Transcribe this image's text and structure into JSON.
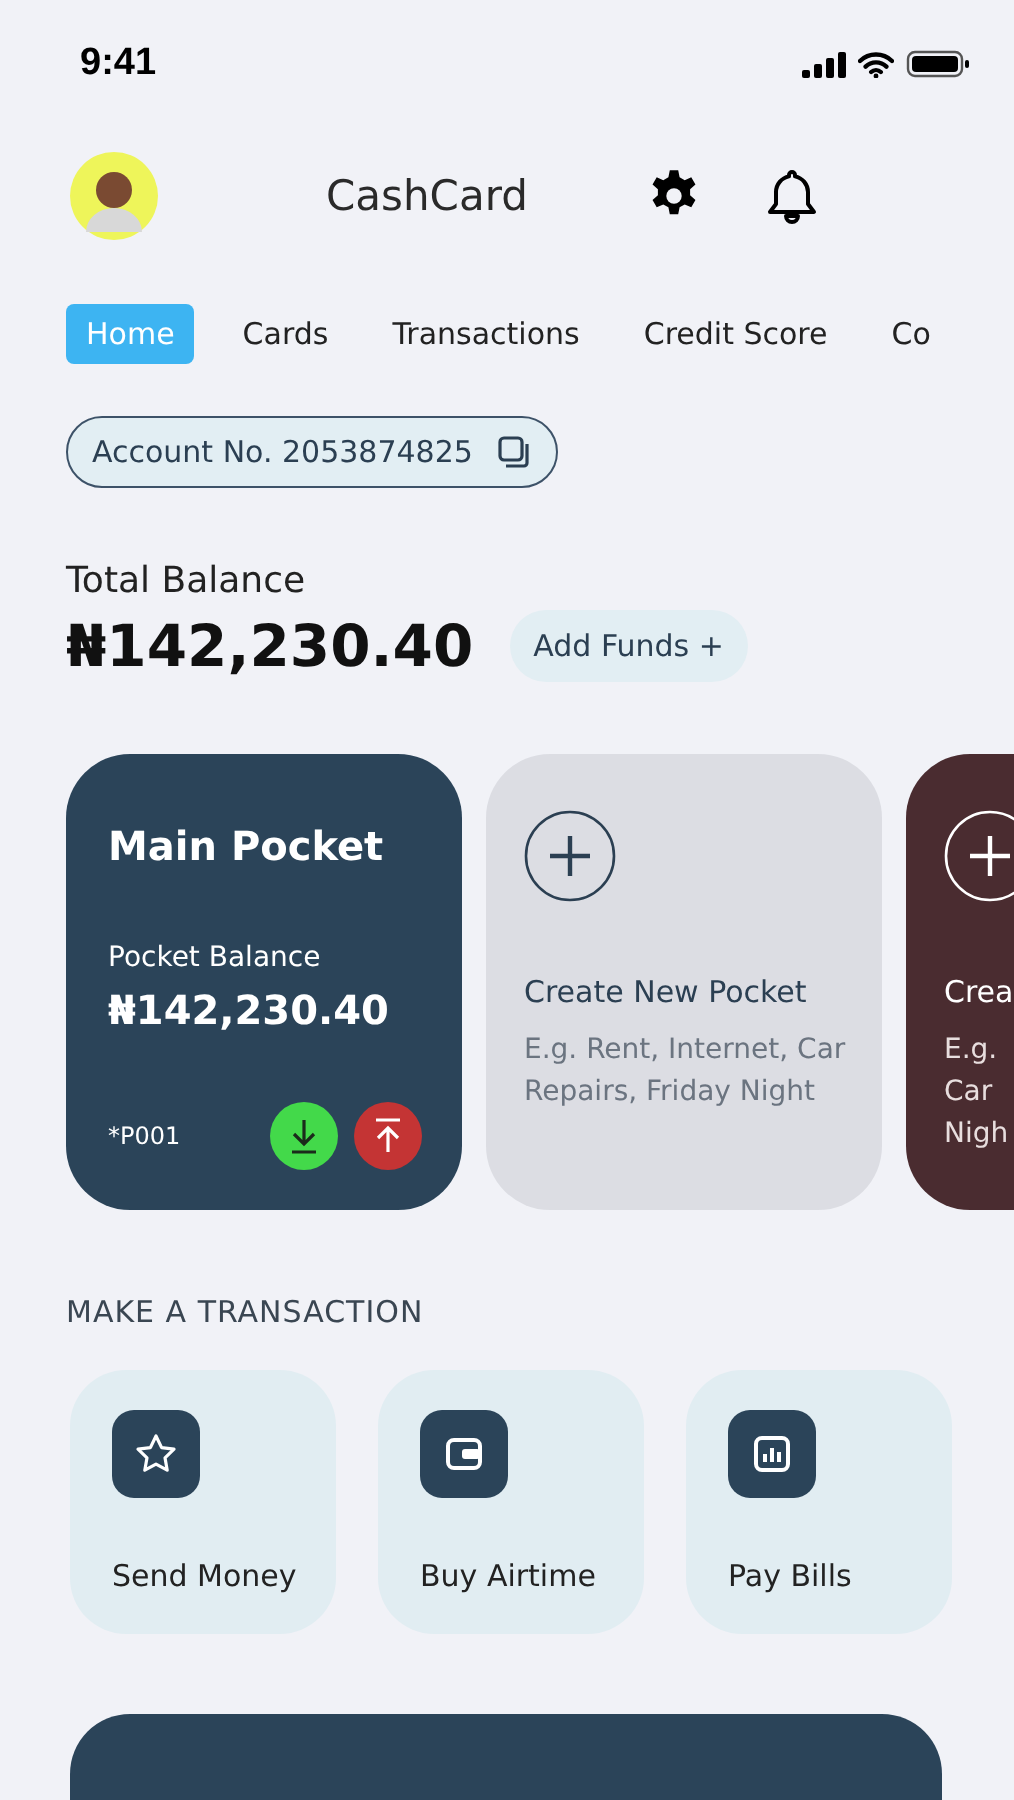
{
  "status_bar": {
    "time": "9:41"
  },
  "header": {
    "title": "CashCard"
  },
  "tabs": [
    {
      "label": "Home",
      "selected": true
    },
    {
      "label": "Cards",
      "selected": false
    },
    {
      "label": "Transactions",
      "selected": false
    },
    {
      "label": "Credit Score",
      "selected": false
    },
    {
      "label": "Co",
      "selected": false
    }
  ],
  "account": {
    "label": "Account No. 2053874825"
  },
  "balance": {
    "label": "Total Balance",
    "amount": "₦142,230.40",
    "add_button": "Add Funds +"
  },
  "pockets": [
    {
      "kind": "main",
      "title": "Main Pocket",
      "balance_label": "Pocket Balance",
      "balance": "₦142,230.40",
      "code": "*P001"
    },
    {
      "kind": "create",
      "title": "Create New Pocket",
      "description": "E.g. Rent, Internet, Car Repairs, Friday Night"
    },
    {
      "kind": "create-cut",
      "title": "Crea",
      "description": "E.g. Car Nigh"
    }
  ],
  "transactions": {
    "heading": "MAKE A TRANSACTION",
    "actions": [
      {
        "kind": "star",
        "label": "Send Money"
      },
      {
        "kind": "wallet",
        "label": "Buy Airtime"
      },
      {
        "kind": "chart",
        "label": "Pay Bills"
      }
    ]
  }
}
